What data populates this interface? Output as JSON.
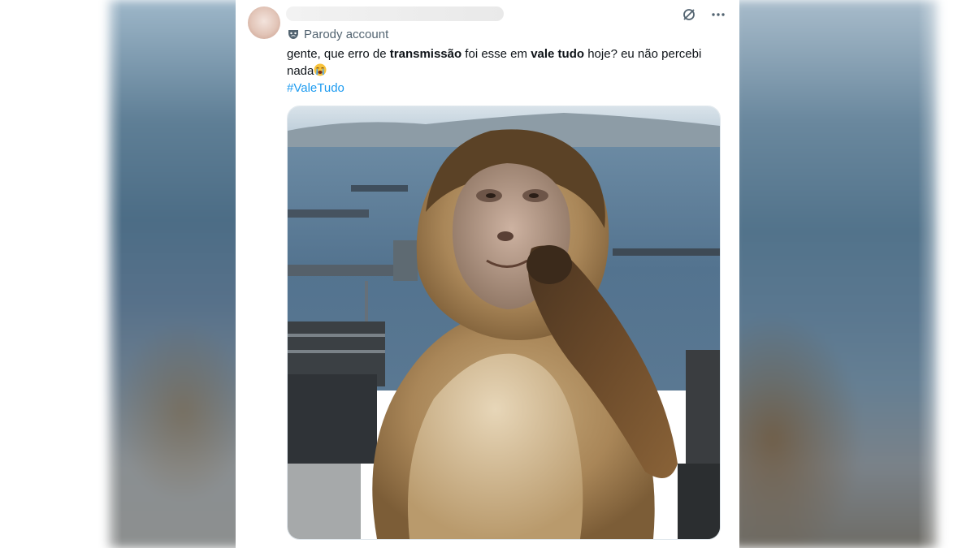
{
  "tweet": {
    "account_label": "Parody account",
    "text": {
      "t1": "gente, que erro de ",
      "b1": "transmissão",
      "t2": " foi esse em ",
      "b2": "vale tudo",
      "t3": " hoje? eu não percebi nada",
      "hashtag": "#ValeTudo"
    },
    "emoji": "loudly-crying-face",
    "media_subject": "monkey-thinking"
  },
  "colors": {
    "text": "#0f1419",
    "secondary": "#536471",
    "link": "#1d9bf0"
  },
  "icons": [
    "mask-icon",
    "grok-icon",
    "more-icon"
  ]
}
